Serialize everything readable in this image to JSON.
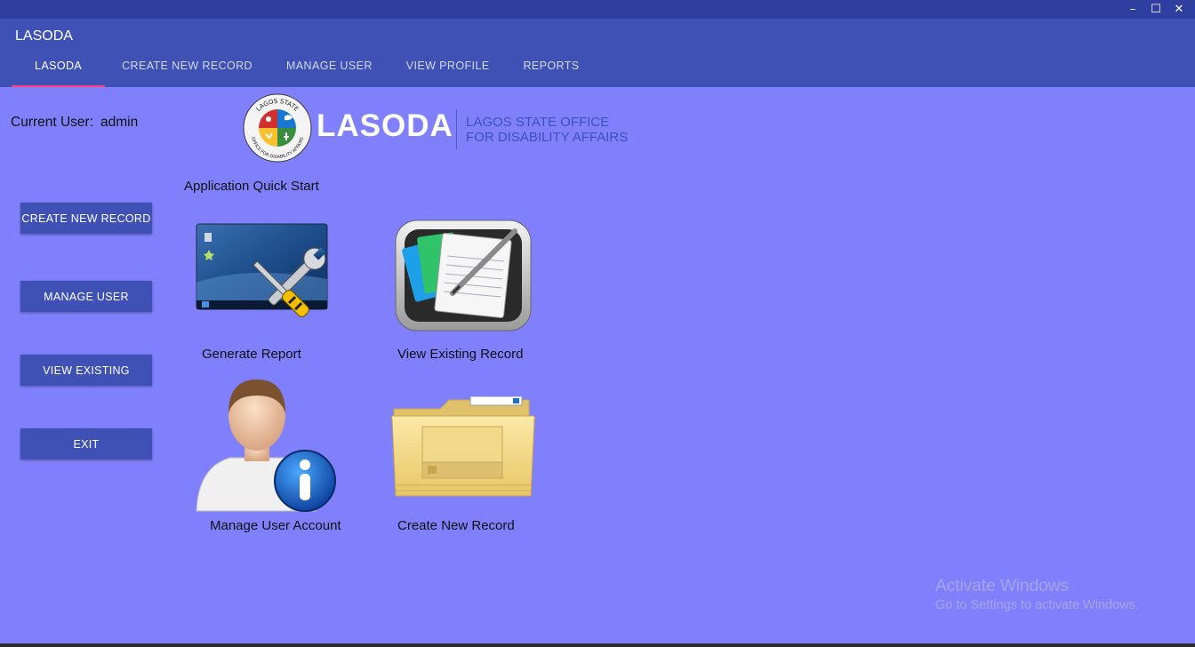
{
  "window": {
    "minimize_glyph": "–",
    "maximize_glyph": "☐",
    "close_glyph": "✕"
  },
  "app": {
    "title": "LASODA"
  },
  "tabs": [
    {
      "label": "LASODA",
      "active": true
    },
    {
      "label": "CREATE NEW RECORD"
    },
    {
      "label": "MANAGE USER"
    },
    {
      "label": "VIEW PROFILE"
    },
    {
      "label": "REPORTS"
    }
  ],
  "user": {
    "label": "Current User:",
    "value": "admin"
  },
  "logo": {
    "seal_top_text": "LAGOS STATE",
    "seal_bottom_text": "OFFICE FOR DISABILITY AFFAIRS",
    "word": "LASODA",
    "subtitle_line1": "LAGOS STATE OFFICE",
    "subtitle_line2": "FOR DISABILITY AFFAIRS"
  },
  "sidebar": {
    "buttons": [
      {
        "label": "CREATE NEW RECORD"
      },
      {
        "label": "MANAGE USER"
      },
      {
        "label": "VIEW EXISTING"
      },
      {
        "label": "EXIT"
      }
    ]
  },
  "quick_start": {
    "title": "Application Quick Start",
    "tiles": [
      {
        "label": "Generate Report",
        "icon": "tools-report-icon"
      },
      {
        "label": "View Existing Record",
        "icon": "records-notepad-icon"
      },
      {
        "label": "Manage User Account",
        "icon": "user-info-icon"
      },
      {
        "label": "Create New Record",
        "icon": "folder-icon"
      }
    ]
  },
  "watermark": {
    "line1": "Activate Windows",
    "line2": "Go to Settings to activate Windows."
  },
  "colors": {
    "background": "#8080fd",
    "appbar": "#3f51b5",
    "titlebar": "#303f9f",
    "tab_indicator": "#ff4081"
  }
}
